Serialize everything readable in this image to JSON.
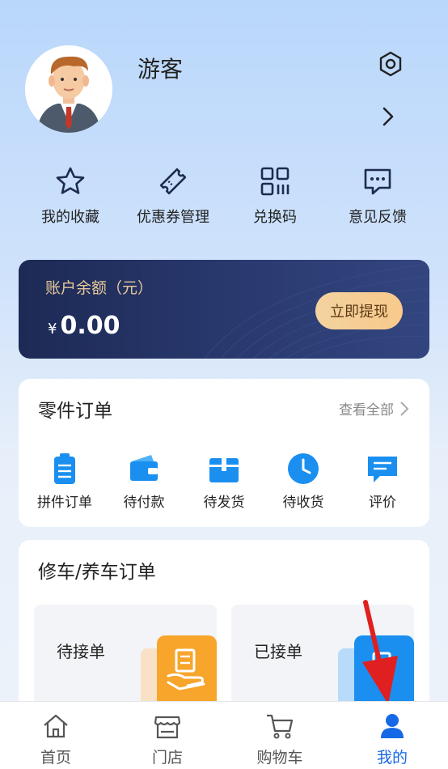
{
  "profile": {
    "username": "游客",
    "settings_icon": "settings-hexagon-icon",
    "chevron_icon": "chevron-right-icon"
  },
  "quick_actions": [
    {
      "label": "我的收藏",
      "icon": "star-icon"
    },
    {
      "label": "优惠券管理",
      "icon": "coupon-icon"
    },
    {
      "label": "兑换码",
      "icon": "qr-code-icon"
    },
    {
      "label": "意见反馈",
      "icon": "feedback-icon"
    }
  ],
  "balance": {
    "title": "账户余额（元）",
    "currency_symbol": "¥",
    "amount": "0.00",
    "withdraw_label": "立即提现"
  },
  "parts_orders": {
    "title": "零件订单",
    "view_all_label": "查看全部",
    "items": [
      {
        "label": "拼件订单",
        "icon": "clipboard-icon"
      },
      {
        "label": "待付款",
        "icon": "wallet-icon"
      },
      {
        "label": "待发货",
        "icon": "package-icon"
      },
      {
        "label": "待收货",
        "icon": "clock-icon"
      },
      {
        "label": "评价",
        "icon": "comment-icon"
      }
    ]
  },
  "repair_orders": {
    "title": "修车/养车订单",
    "tiles": [
      {
        "label": "待接单",
        "icon": "hand-receipt-icon"
      },
      {
        "label": "已接单",
        "icon": "accepted-order-icon"
      }
    ]
  },
  "tabbar": {
    "tabs": [
      {
        "label": "首页",
        "icon": "home-icon",
        "active": false
      },
      {
        "label": "门店",
        "icon": "store-icon",
        "active": false
      },
      {
        "label": "购物车",
        "icon": "cart-icon",
        "active": false
      },
      {
        "label": "我的",
        "icon": "user-icon",
        "active": true
      }
    ]
  },
  "colors": {
    "accent": "#1768e6",
    "card_dark": "#24346a",
    "gold": "#e7c79a",
    "orange": "#f7a52b",
    "blue_icon": "#1a8ff0",
    "annotation_red": "#e02020"
  }
}
